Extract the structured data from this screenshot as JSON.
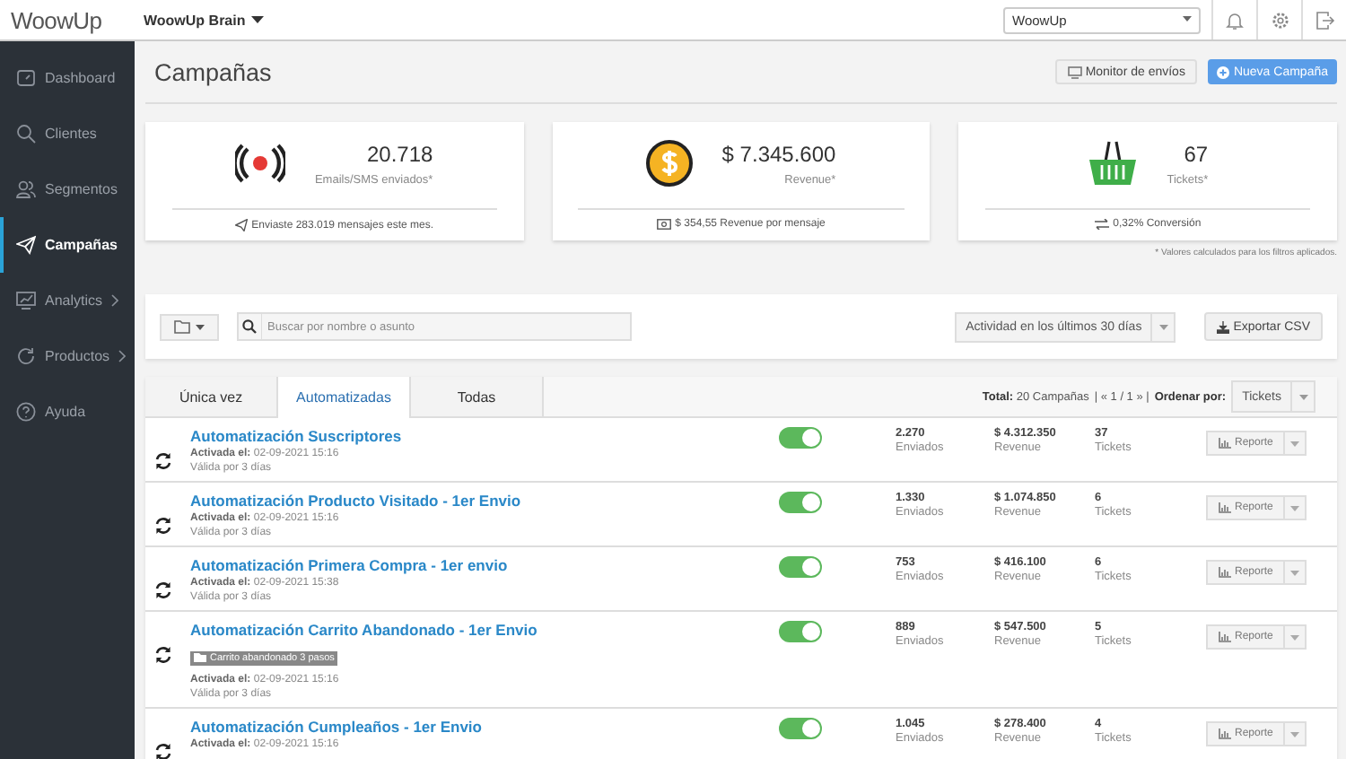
{
  "topbar": {
    "logo": "WoowUp",
    "workspace": "WoowUp Brain",
    "account_select": "WoowUp"
  },
  "sidebar": {
    "items": [
      {
        "label": "Dashboard",
        "kind": "dashboard",
        "selected": false,
        "expandable": false
      },
      {
        "label": "Clientes",
        "kind": "search",
        "selected": false,
        "expandable": false
      },
      {
        "label": "Segmentos",
        "kind": "users",
        "selected": false,
        "expandable": false
      },
      {
        "label": "Campañas",
        "kind": "plane",
        "selected": true,
        "expandable": false
      },
      {
        "label": "Analytics",
        "kind": "chart",
        "selected": false,
        "expandable": true
      },
      {
        "label": "Productos",
        "kind": "refresh",
        "selected": false,
        "expandable": true
      },
      {
        "label": "Ayuda",
        "kind": "help",
        "selected": false,
        "expandable": false
      }
    ]
  },
  "header": {
    "title": "Campañas",
    "monitor_button": "Monitor de envíos",
    "new_button": "Nueva Campaña"
  },
  "stats": [
    {
      "kind": "broadcast",
      "value": "20.718",
      "label": "Emails/SMS enviados*",
      "footer": "Enviaste 283.019 mensajes este mes."
    },
    {
      "kind": "coin",
      "value": "$ 7.345.600",
      "label": "Revenue*",
      "footer": "$ 354,55 Revenue por mensaje"
    },
    {
      "kind": "basket",
      "value": "67",
      "label": "Tickets*",
      "footer": "0,32% Conversión"
    }
  ],
  "footnote": "* Valores calculados para los filtros aplicados.",
  "filters": {
    "search_placeholder": "Buscar por nombre o asunto",
    "period": "Actividad en los últimos 30 días",
    "export_button": "Exportar CSV"
  },
  "tabs": [
    {
      "label": "Única vez",
      "selected": false
    },
    {
      "label": "Automatizadas",
      "selected": true
    },
    {
      "label": "Todas",
      "selected": false
    }
  ],
  "summary": {
    "total_label": "Total:",
    "total": "20 Campañas",
    "pager": "| « 1 / 1 » |",
    "sort_label": "Ordenar por:",
    "sort_value": "Tickets"
  },
  "campaigns": [
    {
      "name": "Automatización Suscriptores",
      "activated_label": "Activada el:",
      "activated": "02-09-2021 15:16",
      "validity": "Válida por 3 días",
      "on": true,
      "sent": "2.270",
      "sent_label": "Enviados",
      "revenue": "$ 4.312.350",
      "revenue_label": "Revenue",
      "tickets": "37",
      "tickets_label": "Tickets",
      "report": "Reporte"
    },
    {
      "name": "Automatización Producto Visitado - 1er Envio",
      "activated_label": "Activada el:",
      "activated": "02-09-2021 15:16",
      "validity": "Válida por 3 días",
      "on": true,
      "sent": "1.330",
      "sent_label": "Enviados",
      "revenue": "$ 1.074.850",
      "revenue_label": "Revenue",
      "tickets": "6",
      "tickets_label": "Tickets",
      "report": "Reporte"
    },
    {
      "name": "Automatización Primera Compra - 1er envio",
      "activated_label": "Activada el:",
      "activated": "02-09-2021 15:38",
      "validity": "Válida por 3 días",
      "on": true,
      "sent": "753",
      "sent_label": "Enviados",
      "revenue": "$ 416.100",
      "revenue_label": "Revenue",
      "tickets": "6",
      "tickets_label": "Tickets",
      "report": "Reporte"
    },
    {
      "name": "Automatización Carrito Abandonado - 1er Envio",
      "tag": "Carrito abandonado 3 pasos",
      "activated_label": "Activada el:",
      "activated": "02-09-2021 15:16",
      "validity": "Válida por 3 días",
      "on": true,
      "sent": "889",
      "sent_label": "Enviados",
      "revenue": "$ 547.500",
      "revenue_label": "Revenue",
      "tickets": "5",
      "tickets_label": "Tickets",
      "report": "Reporte"
    },
    {
      "name": "Automatización Cumpleaños - 1er Envio",
      "activated_label": "Activada el:",
      "activated": "02-09-2021 15:16",
      "on": true,
      "sent": "1.045",
      "sent_label": "Enviados",
      "revenue": "$ 278.400",
      "revenue_label": "Revenue",
      "tickets": "4",
      "tickets_label": "Tickets",
      "report": "Reporte"
    }
  ]
}
